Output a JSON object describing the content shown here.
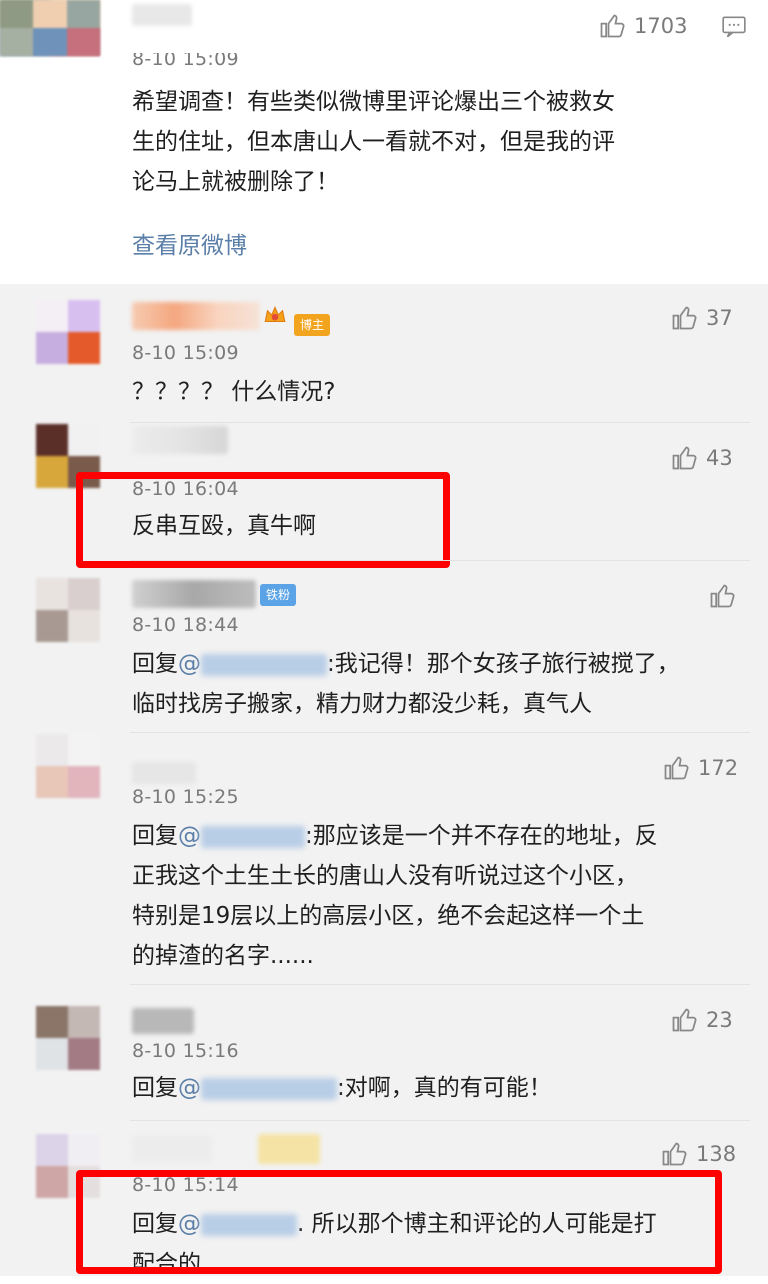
{
  "main_comment": {
    "likes": "1703",
    "time": "8-10 15:09",
    "text_lines": [
      "希望调查！有些类似微博里评论爆出三个被救女",
      "生的住址，但本唐山人一看就不对，但是我的评",
      "论马上就被删除了！"
    ],
    "view_original": "查看原微博"
  },
  "replies": [
    {
      "time": "8-10 15:09",
      "likes": "37",
      "badge": "博主",
      "text": "？？？？ 什么情况?"
    },
    {
      "time": "8-10 16:04",
      "likes": "43",
      "text": "反串互殴，真牛啊"
    },
    {
      "time": "8-10 18:44",
      "likes": "",
      "badge": "铁粉",
      "reply_prefix": "回复",
      "text_lines": [
        ":我记得！那个女孩子旅行被搅了，",
        "临时找房子搬家，精力财力都没少耗，真气人"
      ]
    },
    {
      "time": "8-10 15:25",
      "likes": "172",
      "reply_prefix": "回复",
      "text_lines": [
        ":那应该是一个并不存在的地址，反",
        "正我这个土生土长的唐山人没有听说过这个小区，",
        "特别是19层以上的高层小区，绝不会起这样一个土",
        "的掉渣的名字......"
      ]
    },
    {
      "time": "8-10 15:16",
      "likes": "23",
      "reply_prefix": "回复",
      "text": ":对啊，真的有可能！"
    },
    {
      "time": "8-10 15:14",
      "likes": "138",
      "reply_prefix": "回复",
      "text_lines": [
        ". 所以那个博主和评论的人可能是打",
        "配合的"
      ]
    }
  ],
  "colors": {
    "highlight": "#ff0000",
    "link": "#5b7fa8",
    "badge_host": "#f3a41f",
    "badge_fan": "#5aa3e6"
  }
}
